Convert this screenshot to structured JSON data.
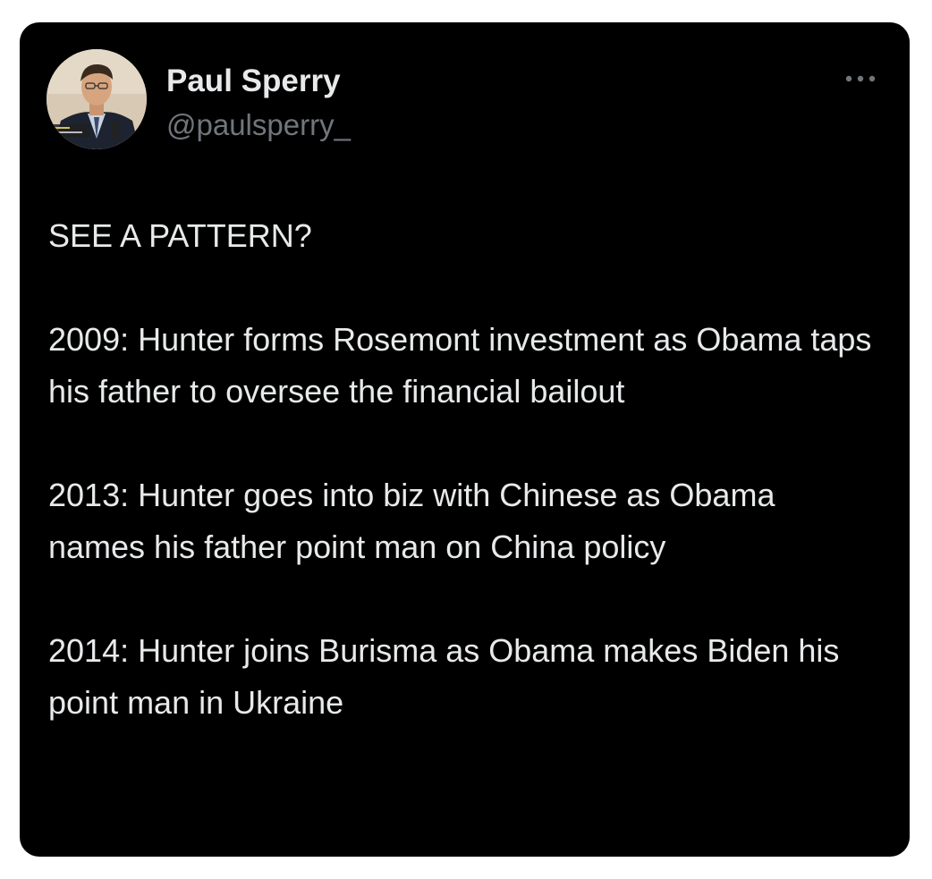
{
  "tweet": {
    "author": {
      "display_name": "Paul Sperry",
      "handle": "@paulsperry_"
    },
    "avatar_icon": "profile-photo",
    "more_icon": "more-options-icon",
    "paragraphs": [
      "SEE A PATTERN?",
      "2009: Hunter forms Rosemont investment as Obama taps his father to oversee the financial bailout",
      "2013: Hunter goes into biz with Chinese as Obama names his father point man on China policy",
      "2014: Hunter joins Burisma as Obama makes Biden his point man in Ukraine"
    ]
  },
  "colors": {
    "page_background": "#ffffff",
    "card_background": "#000000",
    "primary_text": "#e7e9ea",
    "secondary_text": "#71767b"
  }
}
